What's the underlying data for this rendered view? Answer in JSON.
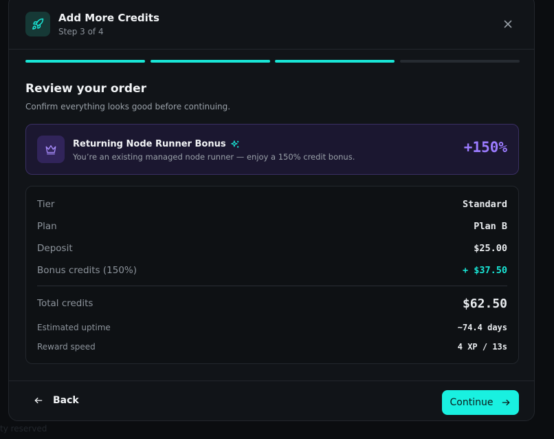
{
  "backdrop": {
    "text": "ty reserved"
  },
  "header": {
    "title": "Add More Credits",
    "subtitle": "Step 3 of 4"
  },
  "progress": {
    "total_steps": 4,
    "current_step": 3
  },
  "review": {
    "title": "Review your order",
    "subtitle": "Confirm everything looks good before continuing."
  },
  "bonus": {
    "title": "Returning Node Runner Bonus",
    "description": "You’re an existing managed node runner — enjoy a 150% credit bonus.",
    "percent": "+150%"
  },
  "summary": {
    "tier_label": "Tier",
    "tier_value": "Standard",
    "plan_label": "Plan",
    "plan_value": "Plan B",
    "deposit_label": "Deposit",
    "deposit_value": "$25.00",
    "bonus_label": "Bonus credits (150%)",
    "bonus_value": "+ $37.50",
    "total_label": "Total credits",
    "total_value": "$62.50",
    "uptime_label": "Estimated uptime",
    "uptime_value": "~74.4 days",
    "speed_label": "Reward speed",
    "speed_value": "4 XP / 13s"
  },
  "footer": {
    "back_label": "Back",
    "continue_label": "Continue"
  },
  "colors": {
    "accent": "#19e6d6",
    "bonus": "#9b7bff",
    "background": "#111418"
  }
}
